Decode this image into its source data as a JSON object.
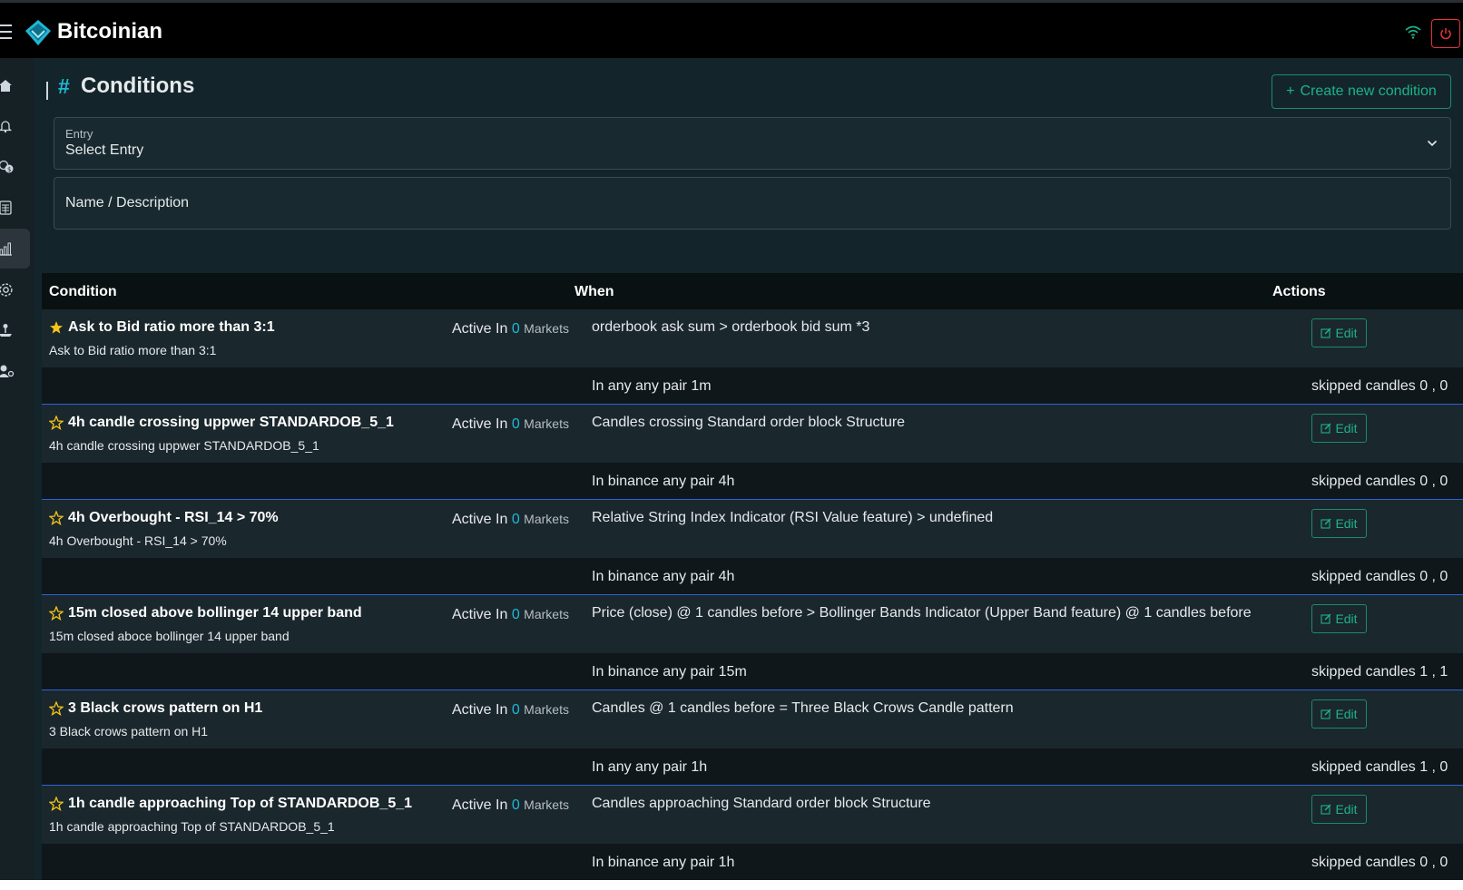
{
  "app": {
    "brand": "Bitcoinian"
  },
  "header": {
    "icons": [
      "menu-icon",
      "logo-icon",
      "wifi-icon",
      "power-icon"
    ]
  },
  "sidebar": {
    "items": [
      {
        "icon": "home-icon"
      },
      {
        "icon": "bell-icon"
      },
      {
        "icon": "coins-icon"
      },
      {
        "icon": "calculator-icon"
      },
      {
        "icon": "chart-icon",
        "active": true
      },
      {
        "icon": "gear-icon"
      },
      {
        "icon": "joystick-icon"
      },
      {
        "icon": "user-gear-icon"
      }
    ]
  },
  "page": {
    "title": "Conditions",
    "hash": "#",
    "create_label": "Create new condition"
  },
  "filters": {
    "entry_label": "Entry",
    "entry_value": "Select Entry",
    "name_placeholder": "Name / Description"
  },
  "table": {
    "headers": {
      "condition": "Condition",
      "when": "When",
      "actions": "Actions"
    },
    "active_in_label": "Active In",
    "markets_label": "Markets",
    "edit_label": "Edit",
    "rows": [
      {
        "starred": true,
        "name": "Ask to Bid ratio more than 3:1",
        "description": "Ask to Bid ratio more than 3:1",
        "active_count": "0",
        "when": "orderbook ask sum > orderbook bid sum *3",
        "scope": "In any any pair 1m",
        "skipped": "skipped candles 0 , 0"
      },
      {
        "starred": false,
        "name": "4h candle crossing uppwer STANDARDOB_5_1",
        "description": "4h candle crossing uppwer STANDARDOB_5_1",
        "active_count": "0",
        "when": "Candles crossing Standard order block Structure",
        "scope": "In binance any pair 4h",
        "skipped": "skipped candles 0 , 0"
      },
      {
        "starred": false,
        "name": "4h Overbought - RSI_14 > 70%",
        "description": "4h Overbought - RSI_14 > 70%",
        "active_count": "0",
        "when": "Relative String Index Indicator (RSI Value feature) > undefined",
        "scope": "In binance any pair 4h",
        "skipped": "skipped candles 0 , 0"
      },
      {
        "starred": false,
        "name": "15m closed above bollinger 14 upper band",
        "description": "15m closed aboce bollinger 14 upper band",
        "active_count": "0",
        "when": "Price (close) @ 1 candles before > Bollinger Bands Indicator (Upper Band feature) @ 1 candles before",
        "scope": "In binance any pair 15m",
        "skipped": "skipped candles 1 , 1"
      },
      {
        "starred": false,
        "name": "3 Black crows pattern on H1",
        "description": "3 Black crows pattern on H1",
        "active_count": "0",
        "when": "Candles @ 1 candles before = Three Black Crows Candle pattern",
        "scope": "In any any pair 1h",
        "skipped": "skipped candles 1 , 0"
      },
      {
        "starred": false,
        "name": "1h candle approaching Top of STANDARDOB_5_1",
        "description": "1h candle approaching Top of STANDARDOB_5_1",
        "active_count": "0",
        "when": "Candles approaching Standard order block Structure",
        "scope": "In binance any pair 1h",
        "skipped": "skipped candles 0 , 0"
      }
    ]
  },
  "colors": {
    "accent": "#1fb8d6",
    "button_green": "#1eb18a",
    "power_red": "#e5343a",
    "star_yellow": "#f5c518",
    "row_divider": "#2c63d6"
  }
}
